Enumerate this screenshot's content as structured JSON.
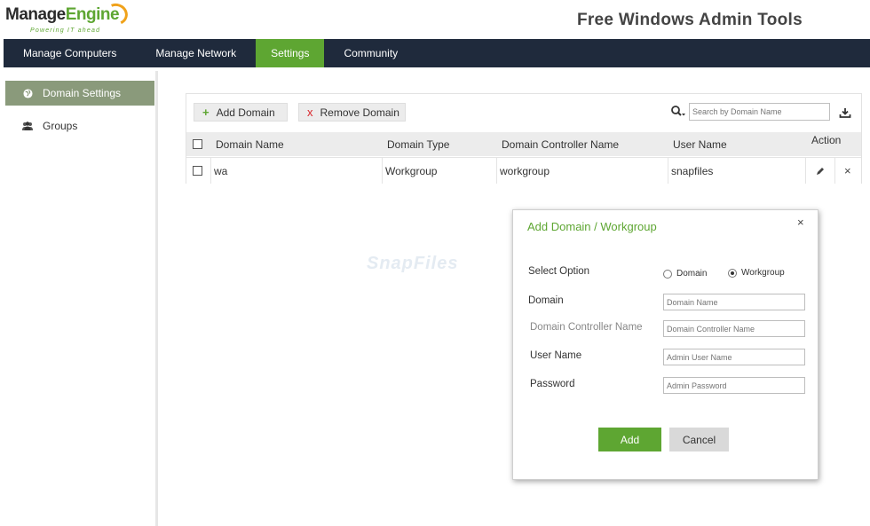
{
  "header": {
    "logo_prefix": "Manage",
    "logo_suffix": "Engine",
    "logo_tagline": "Powering IT ahead",
    "app_title": "Free Windows Admin Tools"
  },
  "nav": {
    "items": [
      {
        "label": "Manage Computers",
        "active": false
      },
      {
        "label": "Manage Network",
        "active": false
      },
      {
        "label": "Settings",
        "active": true
      },
      {
        "label": "Community",
        "active": false
      }
    ]
  },
  "sidebar": {
    "items": [
      {
        "label": "Domain Settings",
        "icon": "globe-icon",
        "active": true
      },
      {
        "label": "Groups",
        "icon": "users-icon",
        "active": false
      }
    ]
  },
  "toolbar": {
    "add_label": "Add Domain",
    "add_symbol": "+",
    "remove_label": "Remove Domain",
    "remove_symbol": "x",
    "search_placeholder": "Search by Domain Name"
  },
  "table": {
    "columns": [
      "Domain Name",
      "Domain Type",
      "Domain Controller Name",
      "User Name",
      "Action"
    ],
    "rows": [
      {
        "domain_name": "wa",
        "domain_type": "Workgroup",
        "controller": "workgroup",
        "user": "snapfiles"
      }
    ]
  },
  "watermark": "SnapFiles",
  "dialog": {
    "title": "Add Domain / Workgroup",
    "close_symbol": "×",
    "select_option_label": "Select Option",
    "option_domain": "Domain",
    "option_workgroup": "Workgroup",
    "selected": "Workgroup",
    "domain_label": "Domain",
    "domain_placeholder": "Domain Name",
    "controller_label": "Domain Controller Name",
    "controller_placeholder": "Domain Controller Name",
    "user_label": "User Name",
    "user_placeholder": "Admin User Name",
    "password_label": "Password",
    "password_placeholder": "Admin Password",
    "add_button": "Add",
    "cancel_button": "Cancel"
  },
  "colors": {
    "accent": "#5ea632",
    "navbar": "#1f2a3c",
    "sidebar_active": "#8a9a7b",
    "remove_red": "#d9262b"
  }
}
